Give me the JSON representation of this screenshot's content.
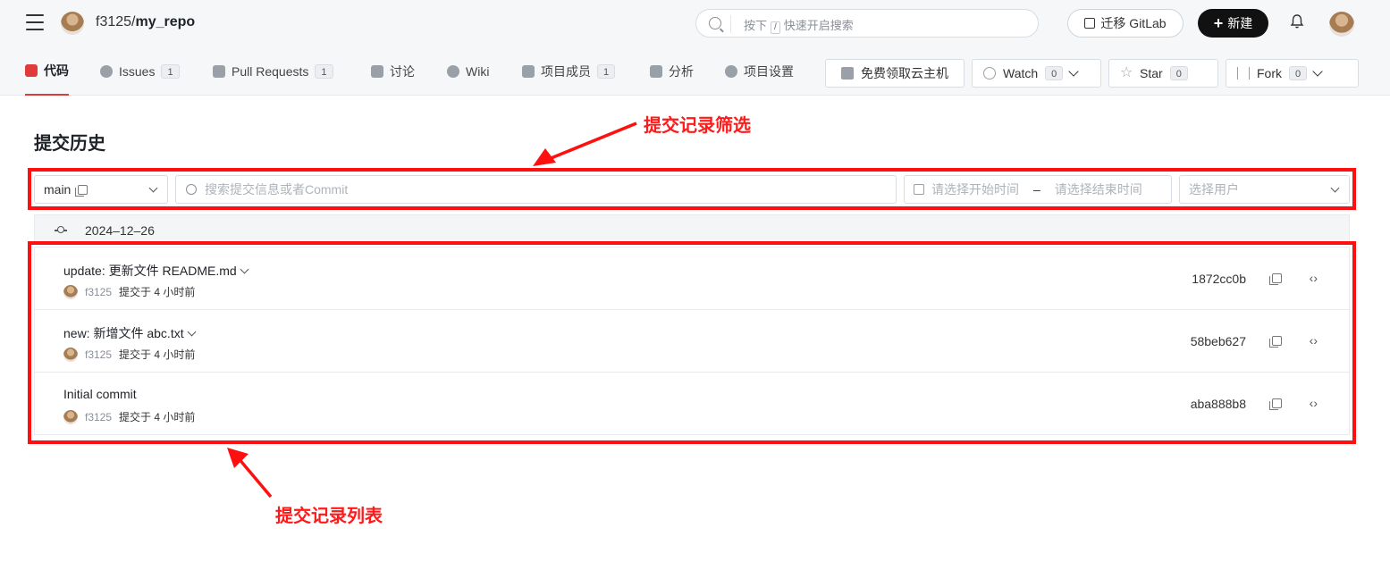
{
  "header": {
    "owner": "f3125",
    "separator": "/",
    "repo": "my_repo",
    "search_hint_prefix": "按下",
    "search_key": "/",
    "search_hint_suffix": "快速开启搜索",
    "migrate_label": "迁移 GitLab",
    "new_label": "新建"
  },
  "nav": {
    "tabs": [
      {
        "label": "代码",
        "active": true
      },
      {
        "label": "Issues",
        "count": "1"
      },
      {
        "label": "Pull Requests",
        "count": "1"
      },
      {
        "label": "讨论"
      },
      {
        "label": "Wiki"
      },
      {
        "label": "项目成员",
        "count": "1"
      },
      {
        "label": "分析"
      },
      {
        "label": "项目设置"
      }
    ],
    "cloud_host_label": "免费领取云主机",
    "watch_label": "Watch",
    "watch_count": "0",
    "star_label": "Star",
    "star_count": "0",
    "fork_label": "Fork",
    "fork_count": "0"
  },
  "page": {
    "title": "提交历史",
    "filter": {
      "branch": "main",
      "search_placeholder": "搜索提交信息或者Commit",
      "start_placeholder": "请选择开始时间",
      "range_dash": "–",
      "end_placeholder": "请选择结束时间",
      "user_placeholder": "选择用户"
    },
    "date_group": "2024–12–26",
    "commits": [
      {
        "message": "update: 更新文件 README.md",
        "author": "f3125",
        "time": "提交于 4 小时前",
        "sha": "1872cc0b",
        "expandable": true
      },
      {
        "message": "new: 新增文件 abc.txt",
        "author": "f3125",
        "time": "提交于 4 小时前",
        "sha": "58beb627",
        "expandable": true
      },
      {
        "message": "Initial commit",
        "author": "f3125",
        "time": "提交于 4 小时前",
        "sha": "aba888b8",
        "expandable": false
      }
    ]
  },
  "annotations": {
    "filter_label": "提交记录筛选",
    "list_label": "提交记录列表",
    "color": "#ff1010"
  },
  "icons": {
    "code_icon": "‹›"
  }
}
